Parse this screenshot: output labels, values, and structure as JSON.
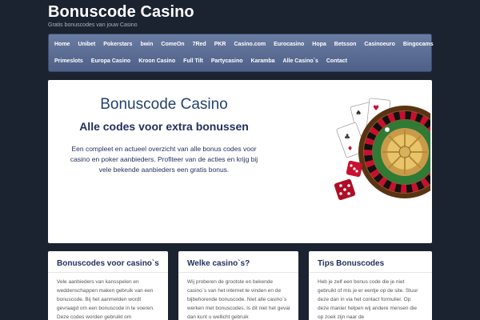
{
  "site": {
    "title": "Bonuscode Casino",
    "tagline": "Gratis bonuscodes van jouw Casino"
  },
  "nav": {
    "row1": [
      "Home",
      "Unibet",
      "Pokerstars",
      "bwin",
      "ComeOn",
      "7Red",
      "PKR",
      "Casino.com",
      "Eurocasino",
      "Hopa",
      "Betsson",
      "Casinoeuro",
      "Bingocams"
    ],
    "row2": [
      "Primeslots",
      "Europa Casino",
      "Kroon Casino",
      "Full Tilt",
      "Partycasino",
      "Karamba",
      "Alle Casino`s",
      "Contact"
    ]
  },
  "hero": {
    "title": "Bonuscode Casino",
    "subtitle": "Alle codes voor extra bonussen",
    "text": "Een compleet en actueel overzicht van alle bonus codes voor casino en poker aanbieders. Profiteer van de acties en krijg bij vele bekende aanbieders een gratis bonus.",
    "image": "roulette-wheel-cards-dice"
  },
  "cards": [
    {
      "title": "Bonuscodes voor casino`s",
      "text": "Vele aanbieders van kansspelen en weddenschappen maken gebruik van een bonuscode. Bij het aanmelden wordt gevraagd om een bonuscode in te voeren. Deze codes worden gebruikt om"
    },
    {
      "title": "Welke casino`s?",
      "text": "Wij proberen de grootste en bekende casino`s van het internet te vinden en de bijbehorende bonuscode. Niet alle casino`s werken met bonuscodes. Is dit niet het geval dan kunt u wellicht gebruik"
    },
    {
      "title": "Tips Bonuscodes",
      "text": "Heb je zelf een bonus code die je niet gebruikt of mis je er eentje op de site. Stuur deze dan in via het contact formulier. Op deze manier helpen wij andere mensen die op zoek zijn naar de"
    }
  ],
  "colors": {
    "background": "#1b2230",
    "nav_gradient_top": "#6b7ca2",
    "nav_gradient_bottom": "#4e6088",
    "heading": "#1f2f5c"
  }
}
